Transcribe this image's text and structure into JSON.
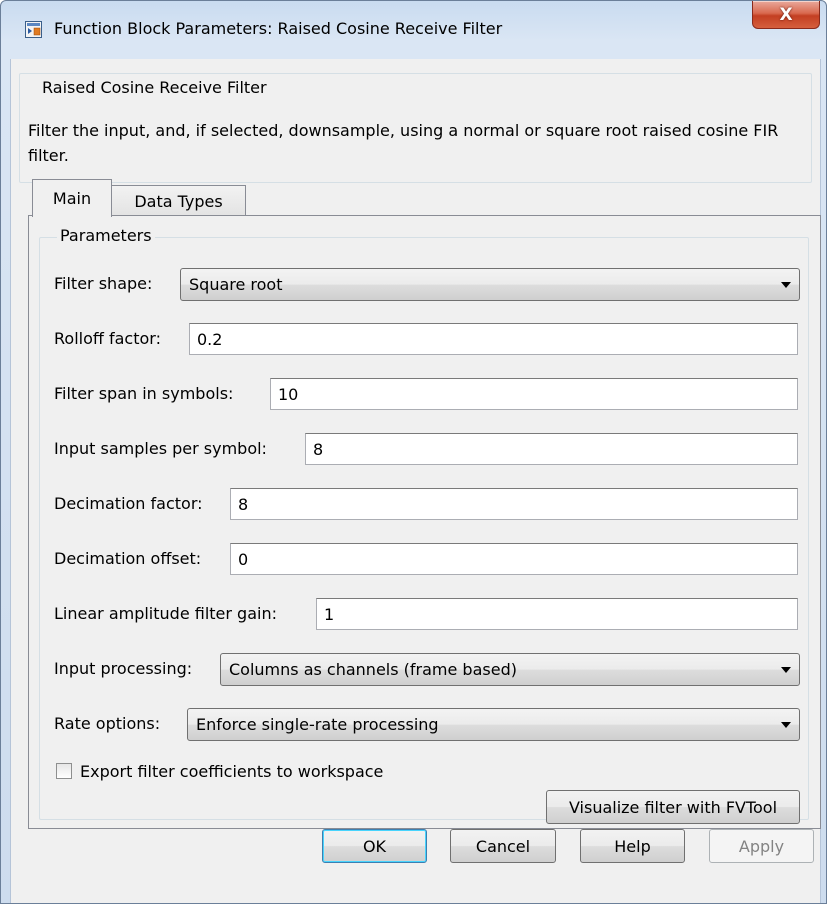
{
  "window": {
    "title": "Function Block Parameters: Raised Cosine Receive Filter",
    "close_glyph": "X",
    "app_icon": "simulink-block-icon"
  },
  "description": {
    "group_title": "Raised Cosine Receive Filter",
    "text": "Filter the input, and, if selected, downsample, using a normal or square root raised cosine FIR filter."
  },
  "tabs": [
    {
      "label": "Main",
      "selected": true
    },
    {
      "label": "Data Types",
      "selected": false
    }
  ],
  "parameters": {
    "group_title": "Parameters",
    "filter_shape": {
      "label": "Filter shape:",
      "value": "Square root"
    },
    "rolloff_factor": {
      "label": "Rolloff factor:",
      "value": "0.2"
    },
    "filter_span": {
      "label": "Filter span in symbols:",
      "value": "10"
    },
    "input_samples": {
      "label": "Input samples per symbol:",
      "value": "8"
    },
    "decimation_factor": {
      "label": "Decimation factor:",
      "value": "8"
    },
    "decimation_offset": {
      "label": "Decimation offset:",
      "value": "0"
    },
    "filter_gain": {
      "label": "Linear amplitude filter gain:",
      "value": "1"
    },
    "input_processing": {
      "label": "Input processing:",
      "value": "Columns as channels (frame based)"
    },
    "rate_options": {
      "label": "Rate options:",
      "value": "Enforce single-rate processing"
    },
    "export_coefficients": {
      "label": "Export filter coefficients to workspace",
      "checked": false
    },
    "visualize_button": "Visualize filter with FVTool"
  },
  "buttons": {
    "ok": "OK",
    "cancel": "Cancel",
    "help": "Help",
    "apply": "Apply"
  }
}
